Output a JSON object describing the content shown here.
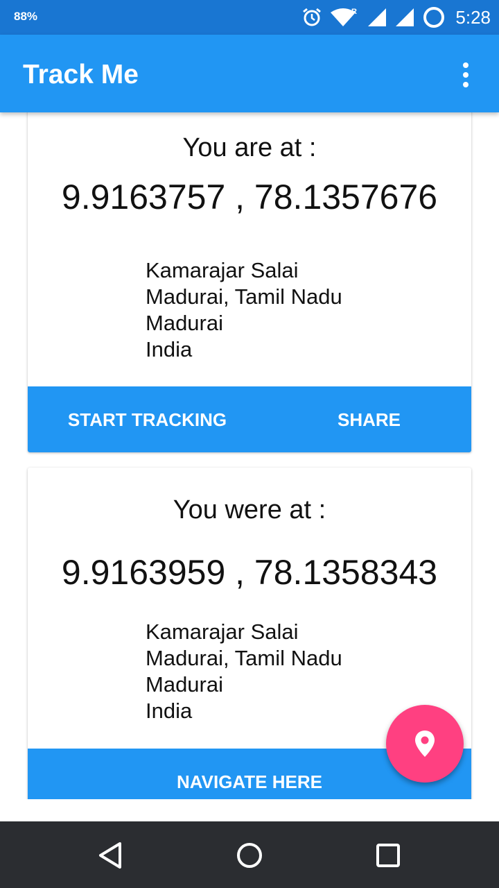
{
  "status_bar": {
    "battery": "88%",
    "time": "5:28",
    "icons": [
      "alarm-icon",
      "wifi-icon",
      "roaming-indicator",
      "signal-icon",
      "signal-icon",
      "sync-ring-icon"
    ]
  },
  "app_bar": {
    "title": "Track Me",
    "menu_icon": "more-vert-icon"
  },
  "current_location": {
    "heading": "You are at :",
    "coordinates": "9.9163757 , 78.1357676",
    "address": [
      "Kamarajar Salai",
      "Madurai, Tamil Nadu",
      "Madurai",
      "India"
    ],
    "actions": [
      "START TRACKING",
      "SHARE"
    ]
  },
  "previous_location": {
    "heading": "You were at :",
    "coordinates": "9.9163959 , 78.1358343",
    "address": [
      "Kamarajar Salai",
      "Madurai, Tamil Nadu",
      "Madurai",
      "India"
    ],
    "actions": [
      "NAVIGATE HERE"
    ]
  },
  "fab": {
    "icon": "location-pin-icon"
  },
  "nav_bar": {
    "icons": [
      "back-icon",
      "home-icon",
      "recents-icon"
    ]
  },
  "colors": {
    "status_bar": "#1976D2",
    "primary": "#2196F3",
    "accent": "#FF4081",
    "nav_bar": "#2b2d31"
  }
}
